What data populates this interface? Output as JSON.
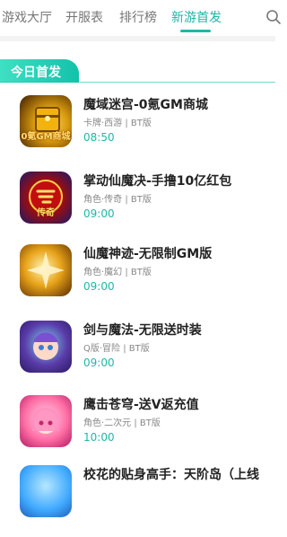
{
  "tabs": [
    {
      "label": "游戏大厅",
      "active": false
    },
    {
      "label": "开服表",
      "active": false
    },
    {
      "label": "排行榜",
      "active": false
    },
    {
      "label": "新游首发",
      "active": true
    }
  ],
  "search_icon": "search-icon",
  "section": {
    "badge_label": "今日首发"
  },
  "games": [
    {
      "title": "魔域迷宫-0氪GM商城",
      "meta": "卡牌·西游 | BT版",
      "time": "08:50",
      "icon_name": "game-icon-moyu",
      "icon_text": "0氪GM商城",
      "icon_colors": [
        "#3b1a00",
        "#f3b30e"
      ]
    },
    {
      "title": "掌动仙魔决-手撸10亿红包",
      "meta": "角色·传奇 | BT版",
      "time": "09:00",
      "icon_name": "game-icon-chuanqi",
      "icon_text": "传奇",
      "icon_colors": [
        "#1a1a6b",
        "#d01b1b"
      ]
    },
    {
      "title": "仙魔神迹-无限制GM版",
      "meta": "角色·魔幻 | BT版",
      "time": "09:00",
      "icon_name": "game-icon-xianmo",
      "icon_text": "",
      "icon_colors": [
        "#e7a319",
        "#ffe7a0"
      ]
    },
    {
      "title": "剑与魔法-无限送时装",
      "meta": "Q版·冒险 | BT版",
      "time": "09:00",
      "icon_name": "game-icon-jianmo",
      "icon_text": "",
      "icon_colors": [
        "#5a3ca8",
        "#7ad7f0"
      ]
    },
    {
      "title": "鹰击苍穹-送V返充值",
      "meta": "角色·二次元 | BT版",
      "time": "10:00",
      "icon_name": "game-icon-yingji",
      "icon_text": "",
      "icon_colors": [
        "#ff6fa5",
        "#ffd6ea"
      ]
    },
    {
      "title": "校花的贴身高手：天阶岛（上线",
      "meta": "",
      "time": "",
      "icon_name": "game-icon-xiaohua",
      "icon_text": "",
      "icon_colors": [
        "#3fa9ff",
        "#b7e7ff"
      ]
    }
  ],
  "accent_color": "#1fb7a8"
}
